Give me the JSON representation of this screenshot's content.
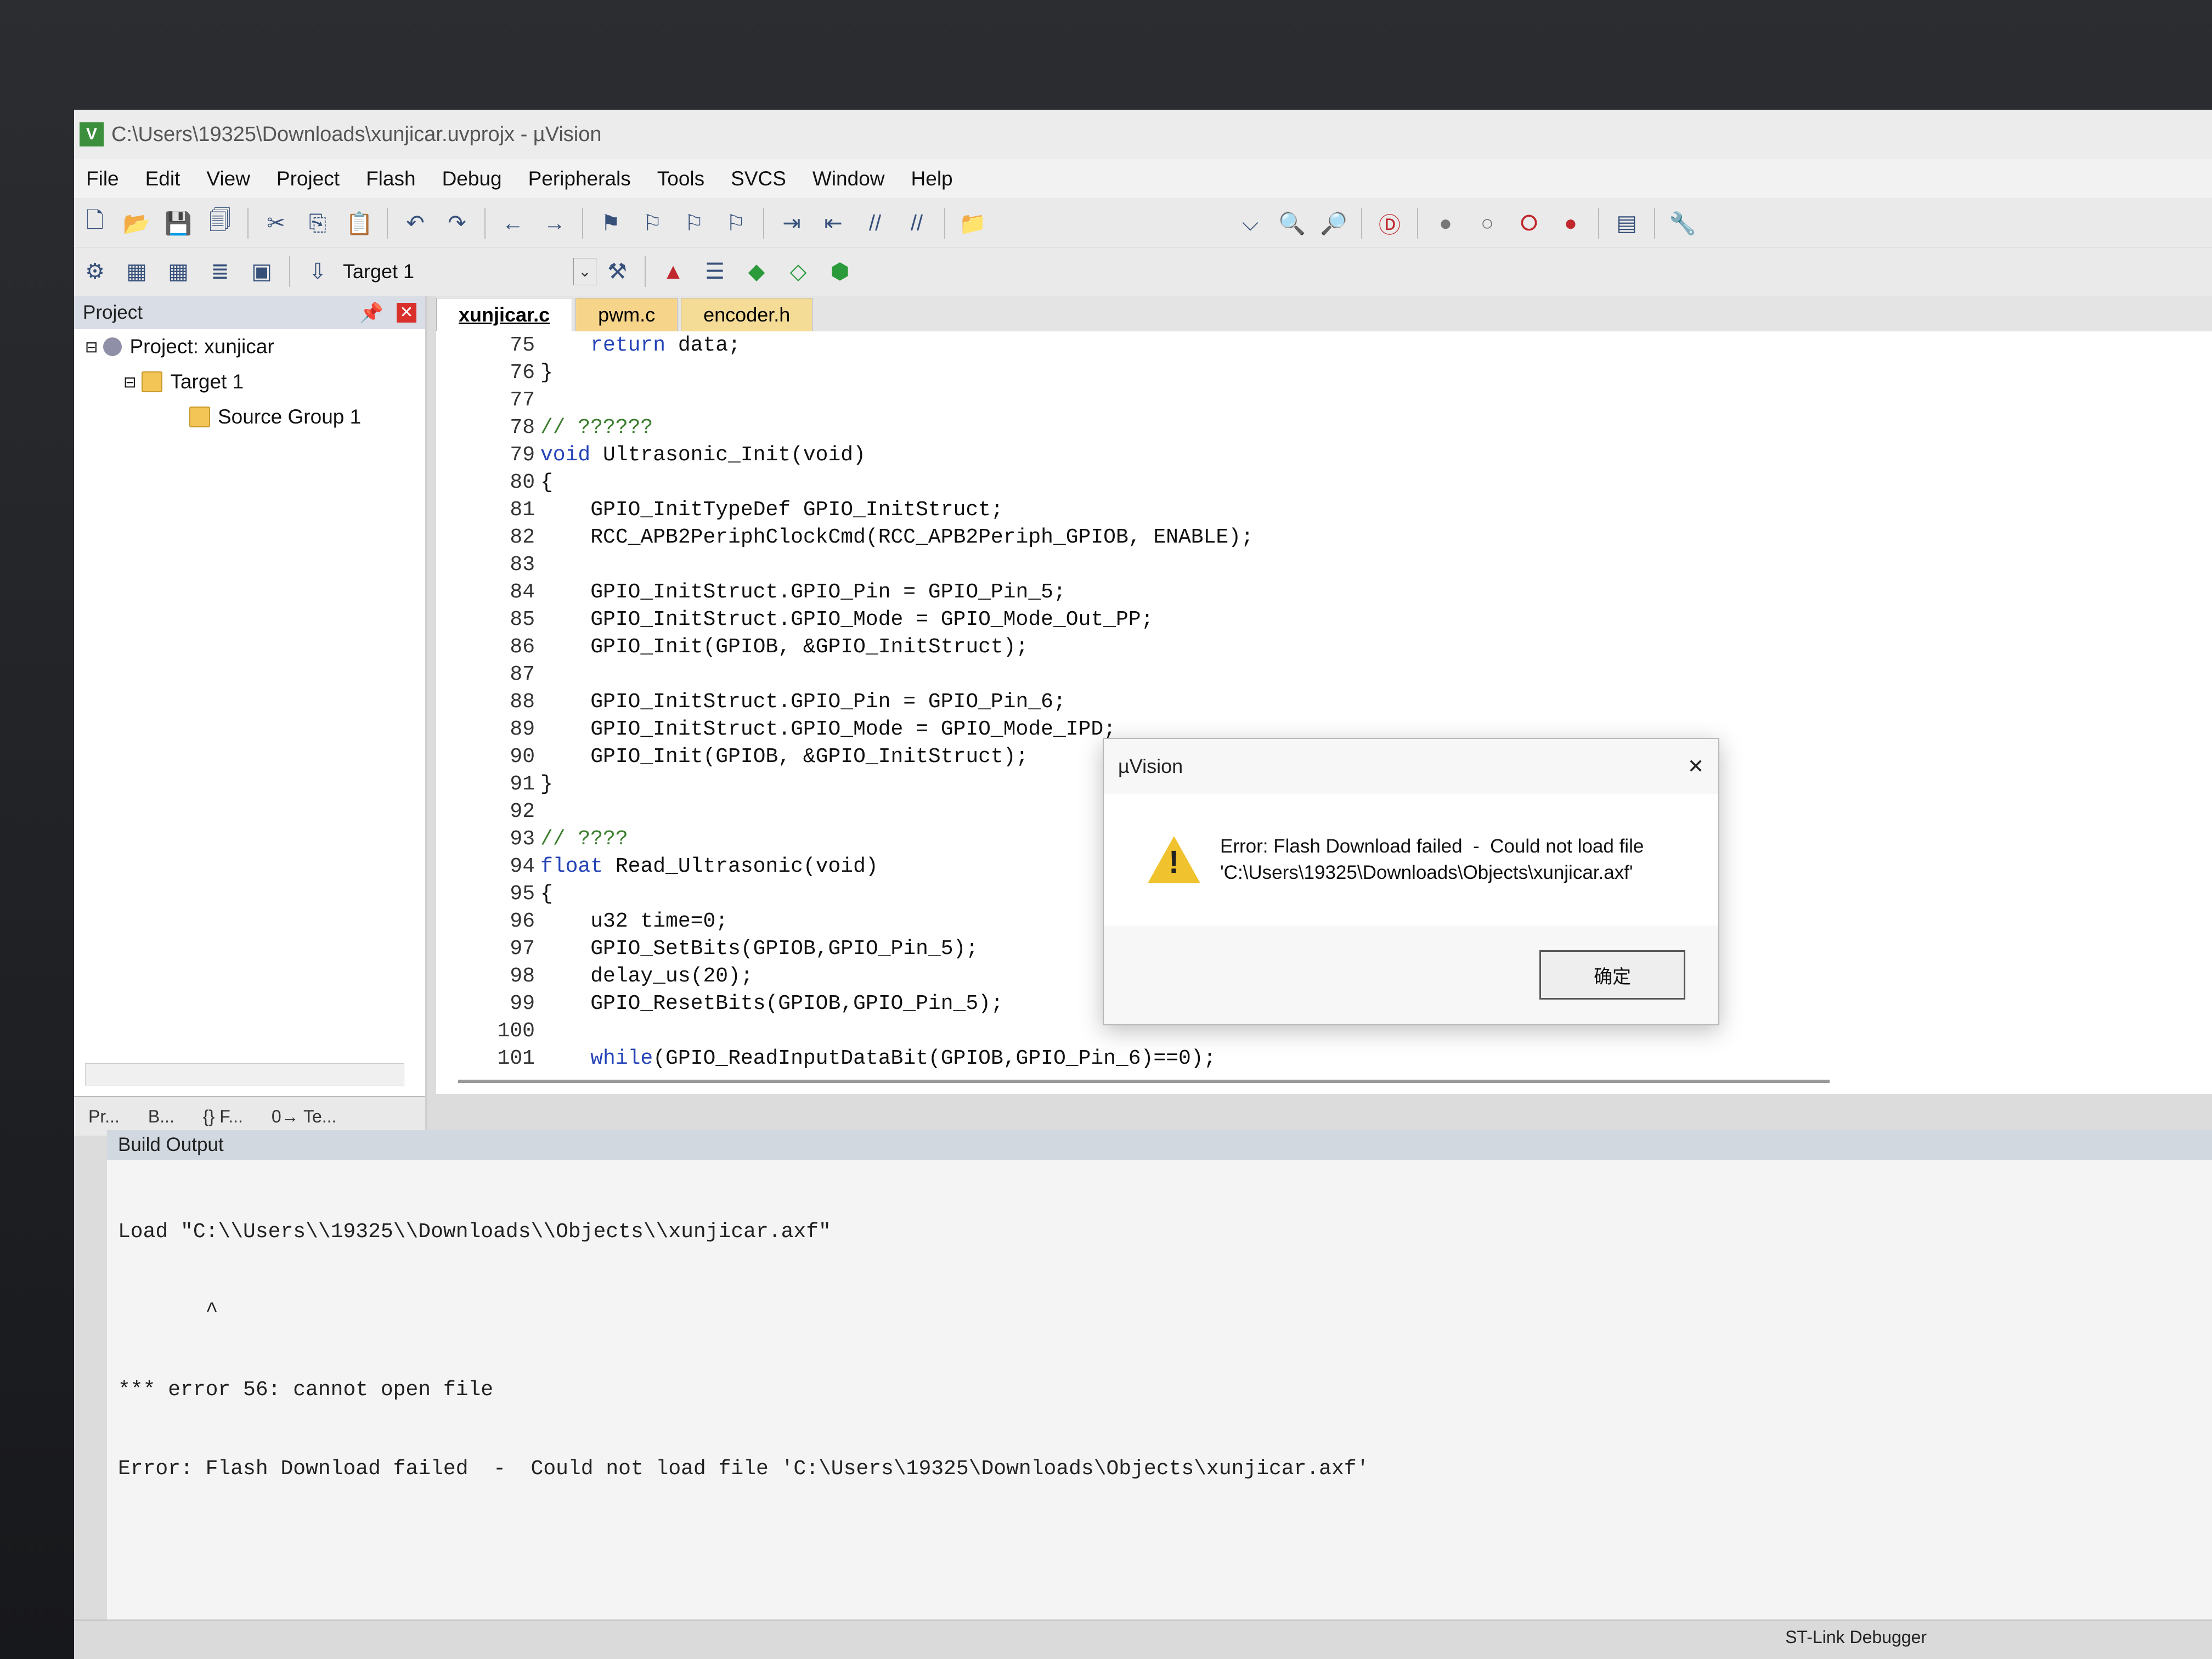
{
  "window": {
    "title": "C:\\Users\\19325\\Downloads\\xunjicar.uvprojx - µVision",
    "icon_name": "uvision-app-icon"
  },
  "menu": [
    "File",
    "Edit",
    "View",
    "Project",
    "Flash",
    "Debug",
    "Peripherals",
    "Tools",
    "SVCS",
    "Window",
    "Help"
  ],
  "toolbar2": {
    "target": "Target 1"
  },
  "project_panel": {
    "header": "Project",
    "tree": [
      {
        "label": "Project: xunjicar",
        "indent": 0
      },
      {
        "label": "Target 1",
        "indent": 1
      },
      {
        "label": "Source Group 1",
        "indent": 2
      }
    ],
    "tabs": [
      "Pr...",
      "B...",
      "{} F...",
      "0→ Te..."
    ]
  },
  "editor": {
    "tabs": [
      "xunjicar.c",
      "pwm.c",
      "encoder.h"
    ],
    "lines": [
      {
        "n": "75",
        "t": "    return data;"
      },
      {
        "n": "76",
        "t": "}"
      },
      {
        "n": "77",
        "t": ""
      },
      {
        "n": "78",
        "t": "// ??????"
      },
      {
        "n": "79",
        "t": "void Ultrasonic_Init(void)"
      },
      {
        "n": "80",
        "t": "{"
      },
      {
        "n": "81",
        "t": "    GPIO_InitTypeDef GPIO_InitStruct;"
      },
      {
        "n": "82",
        "t": "    RCC_APB2PeriphClockCmd(RCC_APB2Periph_GPIOB, ENABLE);"
      },
      {
        "n": "83",
        "t": ""
      },
      {
        "n": "84",
        "t": "    GPIO_InitStruct.GPIO_Pin = GPIO_Pin_5;"
      },
      {
        "n": "85",
        "t": "    GPIO_InitStruct.GPIO_Mode = GPIO_Mode_Out_PP;"
      },
      {
        "n": "86",
        "t": "    GPIO_Init(GPIOB, &GPIO_InitStruct);"
      },
      {
        "n": "87",
        "t": ""
      },
      {
        "n": "88",
        "t": "    GPIO_InitStruct.GPIO_Pin = GPIO_Pin_6;"
      },
      {
        "n": "89",
        "t": "    GPIO_InitStruct.GPIO_Mode = GPIO_Mode_IPD;"
      },
      {
        "n": "90",
        "t": "    GPIO_Init(GPIOB, &GPIO_InitStruct);"
      },
      {
        "n": "91",
        "t": "}"
      },
      {
        "n": "92",
        "t": ""
      },
      {
        "n": "93",
        "t": "// ????"
      },
      {
        "n": "94",
        "t": "float Read_Ultrasonic(void)"
      },
      {
        "n": "95",
        "t": "{"
      },
      {
        "n": "96",
        "t": "    u32 time=0;"
      },
      {
        "n": "97",
        "t": "    GPIO_SetBits(GPIOB,GPIO_Pin_5);"
      },
      {
        "n": "98",
        "t": "    delay_us(20);"
      },
      {
        "n": "99",
        "t": "    GPIO_ResetBits(GPIOB,GPIO_Pin_5);"
      },
      {
        "n": "100",
        "t": ""
      },
      {
        "n": "101",
        "t": "    while(GPIO_ReadInputDataBit(GPIOB,GPIO_Pin_6)==0);"
      }
    ]
  },
  "build_output": {
    "header": "Build Output",
    "lines": [
      "Load \"C:\\\\Users\\\\19325\\\\Downloads\\\\Objects\\\\xunjicar.axf\"",
      "       ^",
      "*** error 56: cannot open file",
      "Error: Flash Download failed  -  Could not load file 'C:\\Users\\19325\\Downloads\\Objects\\xunjicar.axf'"
    ]
  },
  "status_bar": {
    "debugger": "ST-Link Debugger"
  },
  "dialog": {
    "title": "µVision",
    "message": "Error: Flash Download failed  -  Could not load file\n'C:\\Users\\19325\\Downloads\\Objects\\xunjicar.axf'",
    "ok_label": "确定",
    "icon_name": "warning-icon"
  }
}
